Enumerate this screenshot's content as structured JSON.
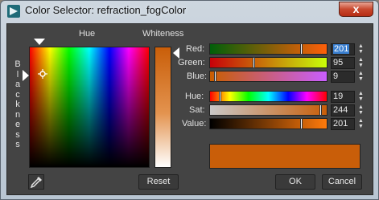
{
  "window": {
    "title": "Color Selector: refraction_fogColor",
    "close_label": "x"
  },
  "labels": {
    "hue": "Hue",
    "whiteness": "Whiteness",
    "blackness": "Blackness"
  },
  "rgb": [
    {
      "label": "Red:",
      "value": "201",
      "fraction": 0.79,
      "selected": true
    },
    {
      "label": "Green:",
      "value": "95",
      "fraction": 0.37
    },
    {
      "label": "Blue:",
      "value": "9",
      "fraction": 0.035
    }
  ],
  "hsv": [
    {
      "label": "Hue:",
      "value": "19",
      "fraction": 0.075
    },
    {
      "label": "Sat:",
      "value": "244",
      "fraction": 0.957
    },
    {
      "label": "Value:",
      "value": "201",
      "fraction": 0.79
    }
  ],
  "current_color": "#c95e09",
  "buttons": {
    "reset": "Reset",
    "ok": "OK",
    "cancel": "Cancel"
  }
}
